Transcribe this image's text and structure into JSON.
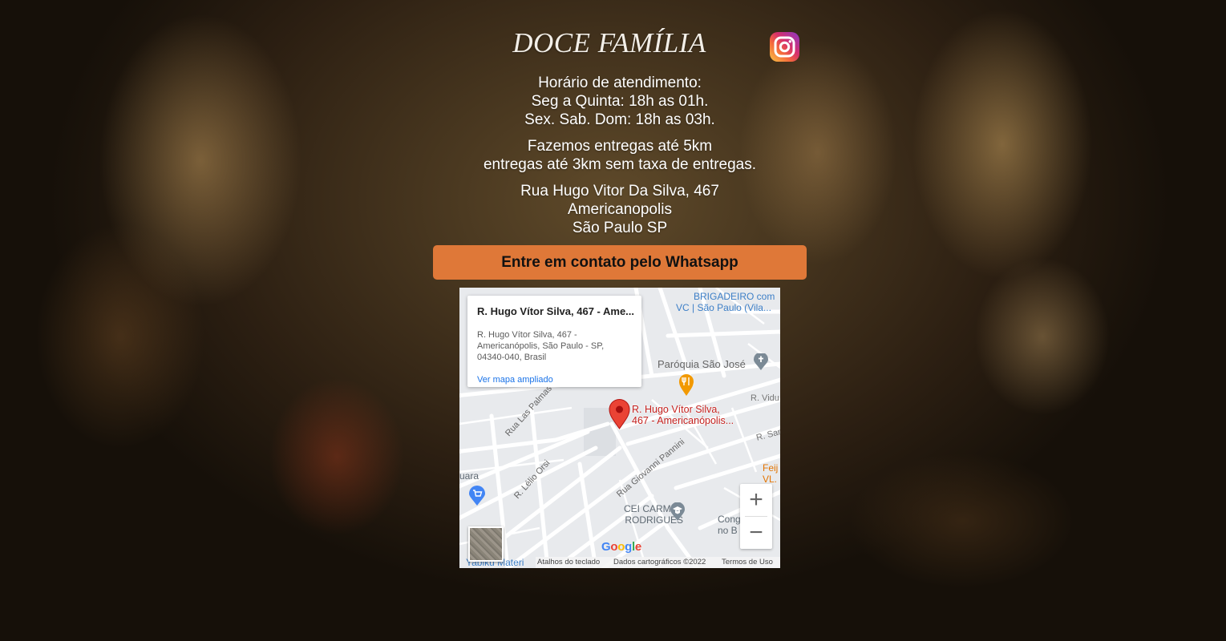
{
  "header": {
    "brand": "DOCE FAMÍLIA",
    "instagram_icon": "instagram-icon"
  },
  "hours": {
    "title": "Horário de atendimento:",
    "weekdays": "Seg a Quinta: 18h as 01h.",
    "weekend": "Sex. Sab. Dom: 18h as 03h."
  },
  "delivery": {
    "line1": "Fazemos entregas até 5km",
    "line2": "entregas até 3km sem taxa de entregas."
  },
  "address": {
    "street": "Rua Hugo Vitor Da Silva, 467",
    "district": "Americanopolis",
    "city": "São Paulo SP"
  },
  "whatsapp_button": "Entre em contato pelo Whatsapp",
  "map": {
    "card": {
      "title": "R. Hugo Vítor Silva, 467 - Ame...",
      "address_lines": [
        "R. Hugo Vítor Silva, 467 -",
        "Americanópolis, São Paulo - SP,",
        "04340-040, Brasil"
      ],
      "link": "Ver mapa ampliado"
    },
    "marker_label": [
      "R. Hugo Vítor Silva,",
      "467 - Americanópolis..."
    ],
    "labels": {
      "brigadeiro": [
        "BRIGADEIRO com",
        "VC | São Paulo (Vila..."
      ],
      "paroquia": "Paróquia São José",
      "r_vidu": "R. Vidu",
      "r_sar": "R. Sar",
      "rua_las_palmas": "Rua Las Palmas",
      "r_lelio_orsi": "R. Lélio Orsi",
      "rua_giovanni_pannini": "Rua Giovanni Pannini",
      "cei_carmen": [
        "CEI CARMEN",
        "RODRIGUES"
      ],
      "cong": [
        "Cong",
        "no B"
      ],
      "feij": [
        "Feij",
        "VL."
      ],
      "uara": "uara",
      "yabiku": "Yabiku Materi"
    },
    "zoom_in": "+",
    "zoom_out": "−",
    "google": "Google",
    "attribution": {
      "shortcuts": "Atalhos do teclado",
      "data": "Dados cartográficos ©2022",
      "terms": "Termos de Uso"
    }
  }
}
